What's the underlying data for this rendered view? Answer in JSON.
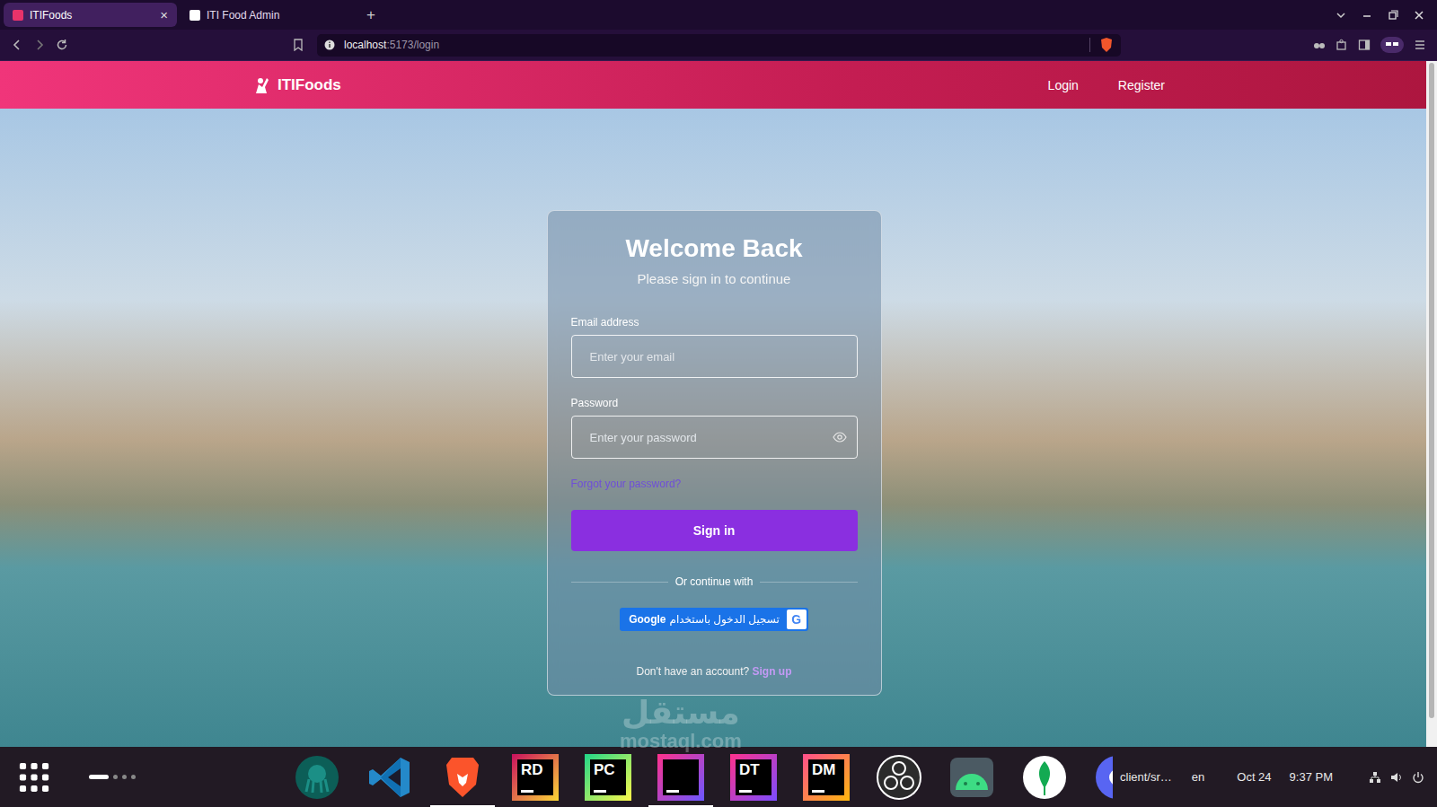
{
  "browser": {
    "tabs": [
      {
        "label": "ITIFoods",
        "selected": true,
        "favicon": "#e8336a"
      },
      {
        "label": "ITI Food Admin",
        "selected": false,
        "favicon": "#ffffff"
      }
    ],
    "close_icon": "×",
    "new_tab": "+",
    "address": {
      "host": "localhost",
      "path": ":5173/login"
    }
  },
  "navbar": {
    "brand": "ITIFoods",
    "links": [
      {
        "label": "Login"
      },
      {
        "label": "Register"
      }
    ]
  },
  "login": {
    "title": "Welcome Back",
    "subtitle": "Please sign in to continue",
    "fields": [
      {
        "label": "Email address",
        "placeholder": "Enter your email",
        "kind": "text"
      },
      {
        "label": "Password",
        "placeholder": "Enter your password",
        "kind": "password"
      }
    ],
    "forgot": "Forgot your password?",
    "submit": "Sign in",
    "divider": "Or continue with",
    "google": {
      "label": "تسجيل الدخول باستخدام",
      "brand": "Google",
      "icon": "G"
    },
    "signup_prompt": "Don't have an account?",
    "signup_link": "Sign up"
  },
  "taskbar": {
    "workspaces": [
      {
        "selected": true
      },
      {
        "selected": false
      },
      {
        "selected": false
      },
      {
        "selected": false
      }
    ],
    "apps": [
      {
        "kind": "octopus",
        "label": "",
        "color": "#1b8f86",
        "accent": "#0c5e57",
        "running": false
      },
      {
        "kind": "vscode",
        "label": "",
        "color": "#2489ca",
        "accent": "#1070b3",
        "running": false
      },
      {
        "kind": "lion",
        "label": "",
        "color": "#fb542b",
        "accent": "#f1562b",
        "running": true
      },
      {
        "kind": "tile",
        "label": "RD",
        "color": "#c90f5e",
        "accent": "#fdd835",
        "running": false
      },
      {
        "kind": "tile",
        "label": "PC",
        "color": "#21d789",
        "accent": "#fcf84a",
        "running": false
      },
      {
        "kind": "tile",
        "label": "",
        "color": "#ff318c",
        "accent": "#6b57ff",
        "running": true
      },
      {
        "kind": "tile",
        "label": "DT",
        "color": "#ff318c",
        "accent": "#7b4cff",
        "running": false
      },
      {
        "kind": "tile",
        "label": "DM",
        "color": "#ff4f8b",
        "accent": "#fdb60d",
        "running": false
      },
      {
        "kind": "obs",
        "label": "",
        "color": "#2b2b2b",
        "accent": "#ffffff",
        "running": false
      },
      {
        "kind": "android",
        "label": "",
        "color": "#3ddc84",
        "accent": "#1a7f4b",
        "running": false
      },
      {
        "kind": "leaf",
        "label": "",
        "color": "#ffffff",
        "accent": "#13aa52",
        "running": false
      },
      {
        "kind": "partial",
        "label": "",
        "color": "#5865f2",
        "accent": "#ffffff",
        "running": false
      }
    ],
    "task": "client/sr…",
    "lang": "en",
    "date": "Oct 24",
    "time": "9:37 PM"
  },
  "watermark": {
    "arabic": "مستقل",
    "latin": "mostaql.com"
  }
}
